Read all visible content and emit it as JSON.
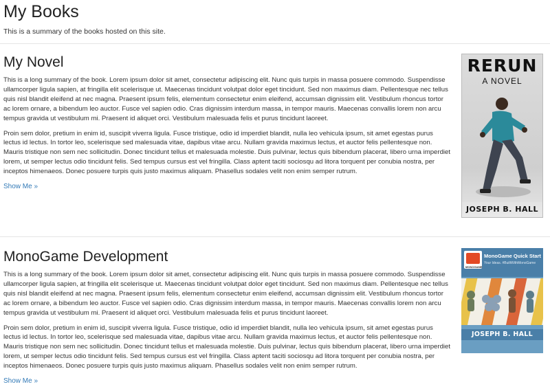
{
  "page": {
    "title": "My Books",
    "subtitle": "This is a summary of the books hosted on this site."
  },
  "books": [
    {
      "title": "My Novel",
      "paragraphs": [
        "This is a long summary of the book. Lorem ipsum dolor sit amet, consectetur adipiscing elit. Nunc quis turpis in massa posuere commodo. Suspendisse ullamcorper ligula sapien, at fringilla elit scelerisque ut. Maecenas tincidunt volutpat dolor eget tincidunt. Sed non maximus diam. Pellentesque nec tellus quis nisl blandit eleifend at nec magna. Praesent ipsum felis, elementum consectetur enim eleifend, accumsan dignissim elit. Vestibulum rhoncus tortor ac lorem ornare, a bibendum leo auctor. Fusce vel sapien odio. Cras dignissim interdum massa, in tempor mauris. Maecenas convallis lorem non arcu tempus gravida ut vestibulum mi. Praesent id aliquet orci. Vestibulum malesuada felis et purus tincidunt laoreet.",
        "Proin sem dolor, pretium in enim id, suscipit viverra ligula. Fusce tristique, odio id imperdiet blandit, nulla leo vehicula ipsum, sit amet egestas purus lectus id lectus. In tortor leo, scelerisque sed malesuada vitae, dapibus vitae arcu. Nullam gravida maximus lectus, et auctor felis pellentesque non. Mauris tristique non sem nec sollicitudin. Donec tincidunt tellus et malesuada molestie. Duis pulvinar, lectus quis bibendum placerat, libero urna imperdiet lorem, ut semper lectus odio tincidunt felis. Sed tempus cursus est vel fringilla. Class aptent taciti sociosqu ad litora torquent per conubia nostra, per inceptos himenaeos. Donec posuere turpis quis justo maximus aliquam. Phasellus sodales velit non enim semper rutrum."
      ],
      "link_label": "Show Me »",
      "cover": {
        "title": "RERUN",
        "subtitle": "A NOVEL",
        "author": "JOSEPH B. HALL"
      }
    },
    {
      "title": "MonoGame Development",
      "paragraphs": [
        "This is a long summary of the book. Lorem ipsum dolor sit amet, consectetur adipiscing elit. Nunc quis turpis in massa posuere commodo. Suspendisse ullamcorper ligula sapien, at fringilla elit scelerisque ut. Maecenas tincidunt volutpat dolor eget tincidunt. Sed non maximus diam. Pellentesque nec tellus quis nisl blandit eleifend at nec magna. Praesent ipsum felis, elementum consectetur enim eleifend, accumsan dignissim elit. Vestibulum rhoncus tortor ac lorem ornare, a bibendum leo auctor. Fusce vel sapien odio. Cras dignissim interdum massa, in tempor mauris. Maecenas convallis lorem non arcu tempus gravida ut vestibulum mi. Praesent id aliquet orci. Vestibulum malesuada felis et purus tincidunt laoreet.",
        "Proin sem dolor, pretium in enim id, suscipit viverra ligula. Fusce tristique, odio id imperdiet blandit, nulla leo vehicula ipsum, sit amet egestas purus lectus id lectus. In tortor leo, scelerisque sed malesuada vitae, dapibus vitae arcu. Nullam gravida maximus lectus, et auctor felis pellentesque non. Mauris tristique non sem nec sollicitudin. Donec tincidunt tellus et malesuada molestie. Duis pulvinar, lectus quis bibendum placerat, libero urna imperdiet lorem, ut semper lectus odio tincidunt felis. Sed tempus cursus est vel fringilla. Class aptent taciti sociosqu ad litora torquent per conubia nostra, per inceptos himenaeos. Donec posuere turpis quis justo maximus aliquam. Phasellus sodales velit non enim semper rutrum."
      ],
      "link_label": "Show Me »",
      "cover": {
        "title": "MonoGame Quick Start",
        "tagline": "Your Ideas. #BuiltWithMonoGame",
        "logo_text": "MONOGAME",
        "author": "JOSEPH B. HALL"
      }
    }
  ],
  "colors": {
    "link": "#337ab7",
    "monogame_orange": "#e34a25",
    "monogame_blue": "#4a7fa8"
  }
}
